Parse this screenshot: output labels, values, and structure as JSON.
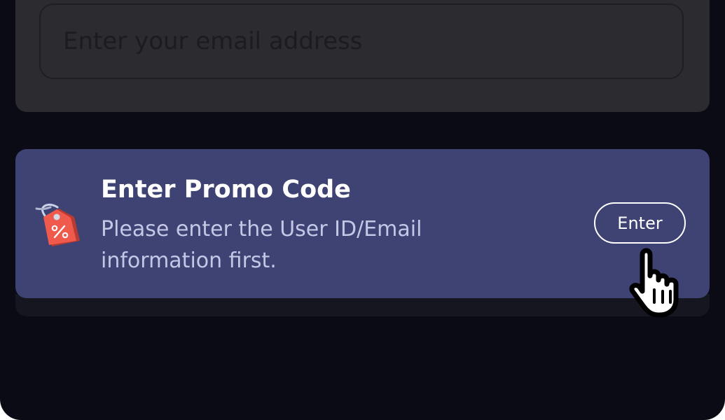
{
  "email": {
    "placeholder": "Enter your email address"
  },
  "promo": {
    "icon": "discount-tag-icon",
    "title": "Enter Promo Code",
    "description": "Please enter the User ID/Email information first.",
    "button_label": "Enter"
  },
  "cursor": {
    "icon": "hand-pointer-icon"
  },
  "colors": {
    "background": "#0a0b14",
    "email_card": "#2b2b30",
    "promo_card": "#3f4373",
    "promo_description": "#c4c7e6",
    "tag_icon": "#ef5a4c"
  }
}
